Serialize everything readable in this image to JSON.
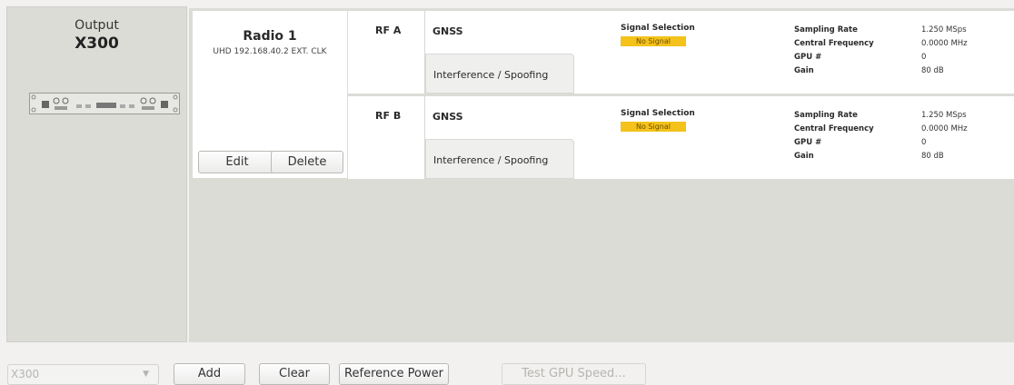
{
  "device": {
    "heading": "Output",
    "model": "X300",
    "image_icon": "x300-front-panel"
  },
  "radio": {
    "name": "Radio 1",
    "info": "UHD 192.168.40.2 EXT. CLK",
    "edit_label": "Edit",
    "delete_label": "Delete"
  },
  "channels": [
    {
      "label": "RF A",
      "tab_active": "GNSS",
      "tab_inactive": "Interference / Spoofing",
      "signal_selection_label": "Signal Selection",
      "signal_status": "No Signal",
      "params": [
        {
          "key": "Sampling Rate",
          "value": "1.250 MSps"
        },
        {
          "key": "Central Frequency",
          "value": "0.0000 MHz"
        },
        {
          "key": "GPU #",
          "value": "0"
        },
        {
          "key": "Gain",
          "value": "80 dB"
        }
      ]
    },
    {
      "label": "RF B",
      "tab_active": "GNSS",
      "tab_inactive": "Interference / Spoofing",
      "signal_selection_label": "Signal Selection",
      "signal_status": "No Signal",
      "params": [
        {
          "key": "Sampling Rate",
          "value": "1.250 MSps"
        },
        {
          "key": "Central Frequency",
          "value": "0.0000 MHz"
        },
        {
          "key": "GPU #",
          "value": "0"
        },
        {
          "key": "Gain",
          "value": "80 dB"
        }
      ]
    }
  ],
  "toolbar": {
    "device_select_value": "X300",
    "add_label": "Add",
    "clear_label": "Clear",
    "reference_power_label": "Reference Power",
    "test_gpu_label": "Test GPU Speed..."
  },
  "colors": {
    "panel_bg": "#dcdcd7",
    "no_signal_badge": "#f4c21a"
  }
}
